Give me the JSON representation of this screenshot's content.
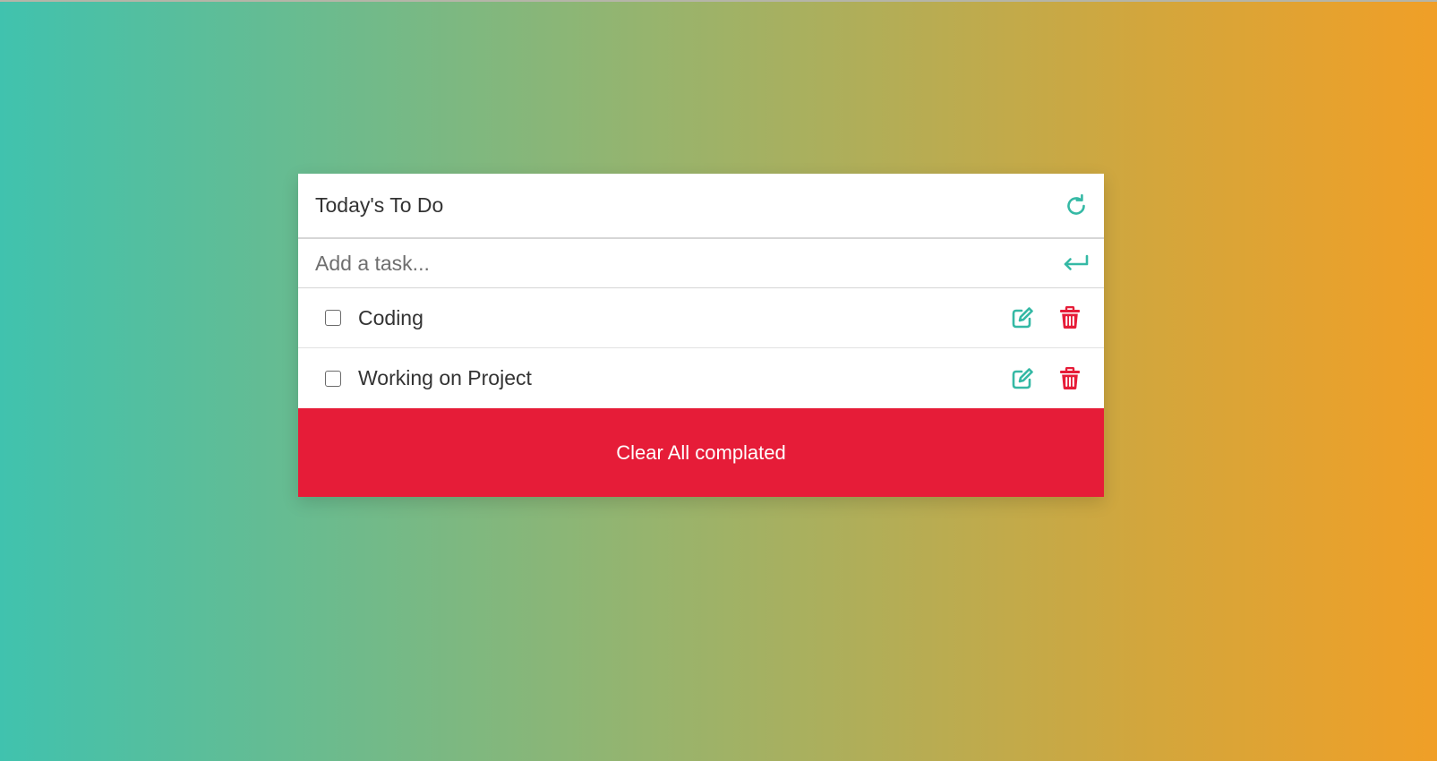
{
  "app": {
    "title": "Today's To Do",
    "input_placeholder": "Add a task...",
    "clear_label": "Clear All complated"
  },
  "tasks": [
    {
      "text": "Coding",
      "completed": false
    },
    {
      "text": "Working on Project",
      "completed": false
    }
  ],
  "icons": {
    "refresh": "refresh-icon",
    "enter": "enter-icon",
    "edit": "edit-icon",
    "delete": "trash-icon"
  },
  "colors": {
    "accent": "#35b9a5",
    "danger": "#e61c38",
    "gradient_start": "#40c2ae",
    "gradient_end": "#f09f27"
  }
}
